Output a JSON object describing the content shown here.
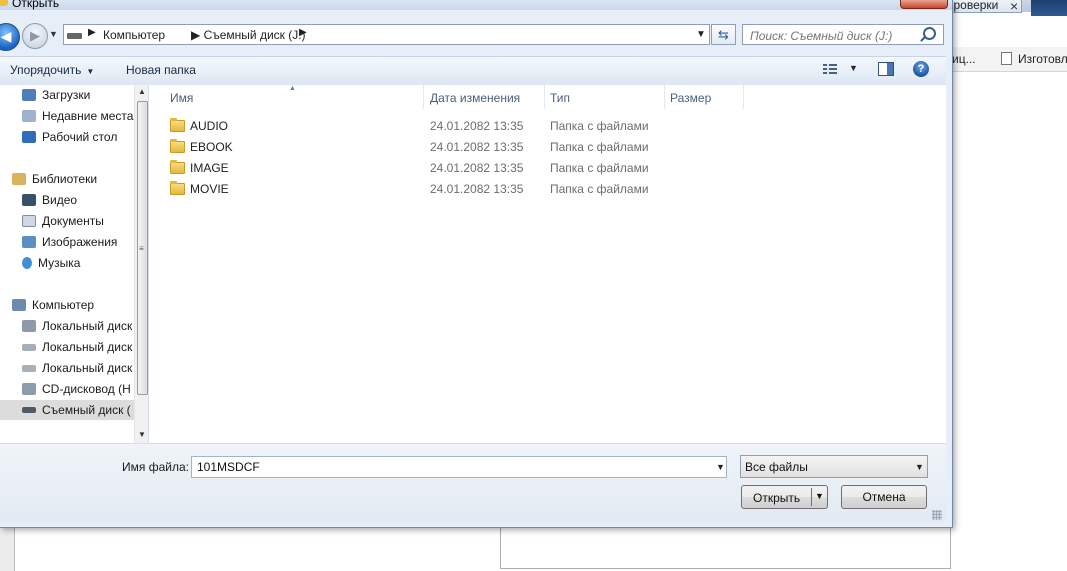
{
  "background": {
    "tab_label": "проверки",
    "bookmark_1": "иц...",
    "bookmark_2": "Изготовл"
  },
  "dialog": {
    "title": "Открыть"
  },
  "address": {
    "crumbs": [
      "Компьютер",
      "Съемный диск (J:)"
    ],
    "search_placeholder": "Поиск: Съемный диск (J:)"
  },
  "toolbar": {
    "organize_label": "Упорядочить",
    "new_folder_label": "Новая папка"
  },
  "nav": {
    "items": [
      {
        "label": "Загрузки",
        "icon": "downloads-icon"
      },
      {
        "label": "Недавние места",
        "icon": "recent-places-icon"
      },
      {
        "label": "Рабочий стол",
        "icon": "desktop-icon"
      },
      {
        "label": "Библиотеки",
        "icon": "libraries-icon"
      },
      {
        "label": "Видео",
        "icon": "video-icon"
      },
      {
        "label": "Документы",
        "icon": "documents-icon"
      },
      {
        "label": "Изображения",
        "icon": "pictures-icon"
      },
      {
        "label": "Музыка",
        "icon": "music-icon"
      },
      {
        "label": "Компьютер",
        "icon": "computer-icon"
      },
      {
        "label": "Локальный диск",
        "icon": "local-disk-icon"
      },
      {
        "label": "Локальный диск",
        "icon": "local-disk-icon"
      },
      {
        "label": "Локальный диск",
        "icon": "local-disk-icon"
      },
      {
        "label": "CD-дисковод (H",
        "icon": "cd-drive-icon"
      },
      {
        "label": "Съемный диск (",
        "icon": "removable-disk-icon",
        "selected": true
      }
    ]
  },
  "columns": {
    "name": "Имя",
    "date": "Дата изменения",
    "type": "Тип",
    "size": "Размер"
  },
  "files": [
    {
      "name": "AUDIO",
      "date": "24.01.2082 13:35",
      "type": "Папка с файлами"
    },
    {
      "name": "EBOOK",
      "date": "24.01.2082 13:35",
      "type": "Папка с файлами"
    },
    {
      "name": "IMAGE",
      "date": "24.01.2082 13:35",
      "type": "Папка с файлами"
    },
    {
      "name": "MOVIE",
      "date": "24.01.2082 13:35",
      "type": "Папка с файлами"
    }
  ],
  "bottom": {
    "filename_label": "Имя файла:",
    "filename_value": "101MSDCF",
    "filetype_value": "Все файлы",
    "open_label": "Открыть",
    "cancel_label": "Отмена"
  }
}
